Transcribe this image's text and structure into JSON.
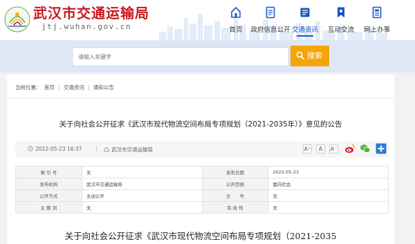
{
  "site": {
    "title": "武汉市交通运输局",
    "domain": "jtj.wuhan.gov.cn"
  },
  "nav": [
    {
      "label": "首页",
      "icon": "home-icon"
    },
    {
      "label": "政府信息公开",
      "icon": "document-icon"
    },
    {
      "label": "交通资讯",
      "icon": "news-icon",
      "active": true
    },
    {
      "label": "互动交流",
      "icon": "bookmark-icon"
    },
    {
      "label": "网上办事",
      "icon": "form-icon"
    }
  ],
  "search": {
    "placeholder": "请输入关键字",
    "button_label": "搜索"
  },
  "breadcrumb": {
    "prefix": "当前位置：",
    "items": [
      "首页",
      "交通资讯",
      "通知公告"
    ]
  },
  "article": {
    "title": "关于向社会公开征求《武汉市现代物流空间布局专项规划（2021-2035年）》意见的公告",
    "date": "2022-05-23 16:37",
    "source": "武汉市交通运输局",
    "body_heading": "关于向社会公开征求《武汉市现代物流空间布局专项规划（2021-2035"
  },
  "font_size_buttons": [
    "A⁺",
    "A",
    "A⁻"
  ],
  "share_icons": [
    "weibo-icon",
    "wechat-icon",
    "add-share-icon"
  ],
  "info_table": [
    {
      "k1": "索 引 号",
      "v1": "无",
      "k2": "发布日期",
      "v2": "2022-05-23"
    },
    {
      "k1": "发布机构",
      "v1": "武汉市交通运输局",
      "k2": "公开范围",
      "v2": "面向社会"
    },
    {
      "k1": "公开方式",
      "v1": "主动公开",
      "k2": "文　　号",
      "v2": "无"
    },
    {
      "k1": "主 题 词",
      "v1": "无",
      "k2": "有 效 性",
      "v2": "无"
    }
  ],
  "colors": {
    "brand_red": "#c8181e",
    "nav_active": "#1a57c4",
    "search_button": "#f5a50a",
    "search_band": "#dfe7f6"
  }
}
